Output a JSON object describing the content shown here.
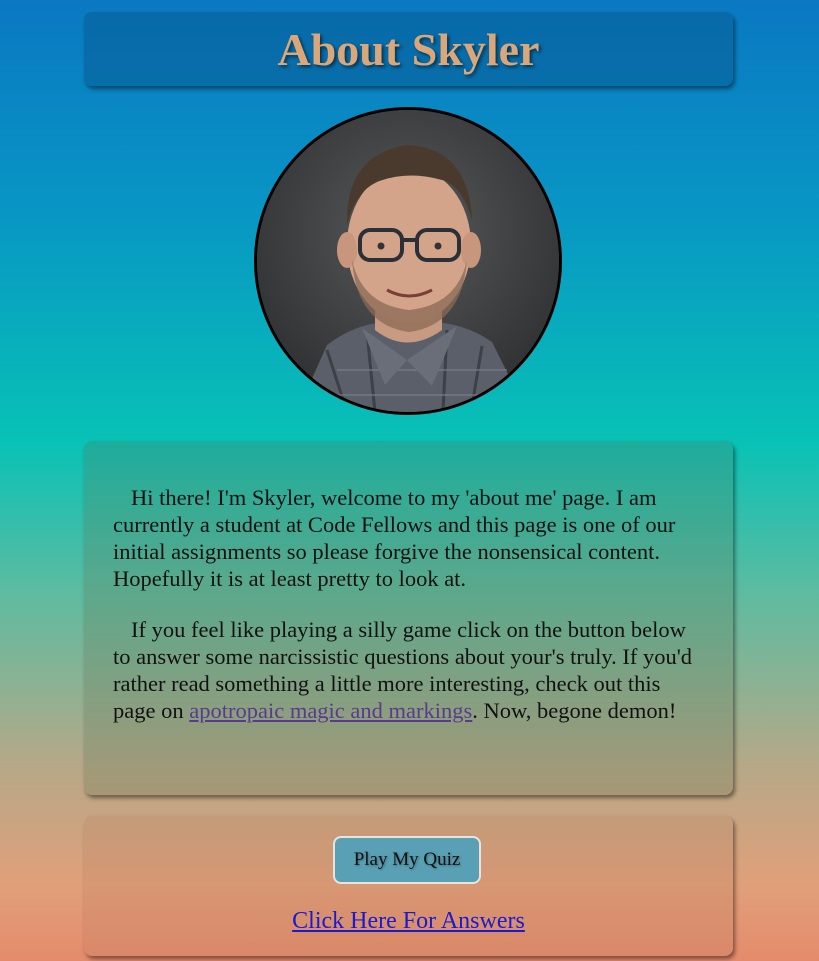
{
  "header": {
    "title": "About Skyler"
  },
  "avatar": {
    "icon": "profile-photo"
  },
  "intro": {
    "paragraph1": "Hi there! I'm Skyler, welcome to my 'about me' page. I am currently a student at Code Fellows and this page is one of our initial assignments so please forgive the nonsensical content. Hopefully it is at least pretty to look at.",
    "paragraph2_before": "If you feel like playing a silly game click on the button below to answer some narcissistic questions about your's truly. If you'd rather read something a little more interesting, check out this page on ",
    "paragraph2_link": "apotropaic magic and markings",
    "paragraph2_after": ". Now, begone demon!"
  },
  "quiz": {
    "button_label": "Play My Quiz",
    "answers_link": "Click Here For Answers"
  },
  "colors": {
    "title": "#d9a77a",
    "link_visited": "#5a3a8c",
    "link": "#1a1ad0",
    "button": "#5aa0b4"
  }
}
